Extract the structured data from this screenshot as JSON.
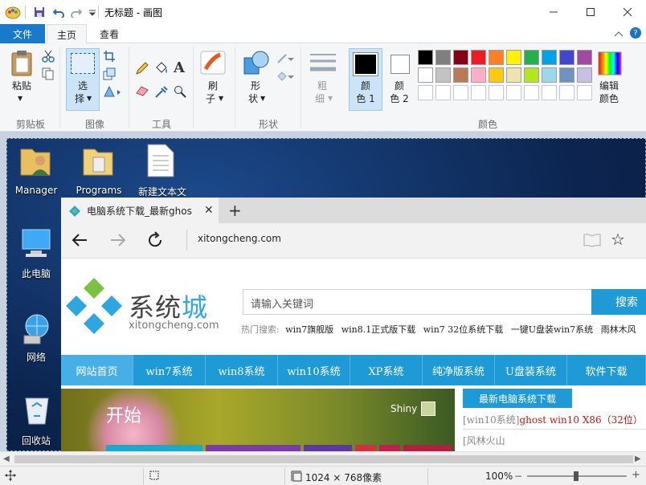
{
  "window": {
    "title": "无标题 - 画图"
  },
  "menu": {
    "file": "文件",
    "home": "主页",
    "view": "查看"
  },
  "ribbon": {
    "paste": "粘贴",
    "select_1": "选",
    "select_2": "择",
    "brush_1": "刷",
    "brush_2": "子",
    "shape_1": "形",
    "shape_2": "状",
    "thickness_1": "粗",
    "thickness_2": "细",
    "color1_1": "颜",
    "color1_2": "色 1",
    "color2_1": "颜",
    "color2_2": "色 2",
    "edit_colors_1": "编辑",
    "edit_colors_2": "颜色",
    "groups": {
      "clipboard": "剪贴板",
      "image": "图像",
      "tools": "工具",
      "shapes": "形状",
      "colors": "颜色"
    },
    "palette_row1": [
      "#000000",
      "#7f7f7f",
      "#880015",
      "#ed1c24",
      "#ff7f27",
      "#fff200",
      "#22b14c",
      "#00a2e8",
      "#3f48cc",
      "#a349a4"
    ],
    "palette_row2": [
      "#ffffff",
      "#c3c3c3",
      "#b97a57",
      "#ffaec9",
      "#ffc90e",
      "#efe4b0",
      "#b5e61d",
      "#99d9ea",
      "#7092be",
      "#c8bfe7"
    ]
  },
  "desktop": {
    "icons": [
      "Manager",
      "Programs",
      "新建文本文",
      "此电脑",
      "网络",
      "回收站"
    ]
  },
  "browser": {
    "tab_title": "电脑系统下载_最新ghos",
    "address": "xitongcheng.com",
    "logo_cn_1": "系统",
    "logo_cn_2": "城",
    "logo_en": "xitongcheng.com",
    "search_placeholder": "请输入关键词",
    "search_button": "搜索",
    "hot_label": "热门搜索:",
    "hot_links": [
      "win7旗舰版",
      "win8.1正式版下载",
      "win7 32位系统下载",
      "一键U盘装win7系统",
      "雨林木风"
    ],
    "nav": [
      "网站首页",
      "win7系统",
      "win8系统",
      "win10系统",
      "XP系统",
      "纯净版系统",
      "U盘装系统",
      "软件下载"
    ],
    "banner_text": "开始",
    "banner_user": "Shiny",
    "news_header": "最新电脑系统下载",
    "news_1_tag": "[win10系统]",
    "news_1_title": "ghost win10 X86（32位）",
    "news_2_tag": "[风林火山"
  },
  "status": {
    "size": "1024 × 768像素",
    "zoom": "100%"
  }
}
